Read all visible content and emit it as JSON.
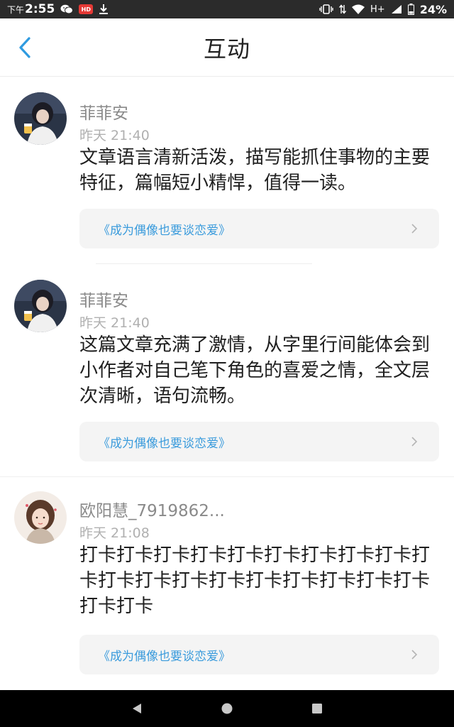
{
  "status_bar": {
    "time_prefix": "下午",
    "time": "2:55",
    "network": "H+",
    "battery": "24%",
    "hd_badge": "HD",
    "icons": [
      "wechat-icon",
      "hd-video-icon",
      "download-icon",
      "vibrate-icon",
      "data-arrows-icon",
      "wifi-icon",
      "signal-icon",
      "battery-icon"
    ]
  },
  "header": {
    "title": "互动",
    "back_icon": "chevron-left-icon"
  },
  "theme": {
    "accent": "#3a9bdc",
    "status_bg": "#2b2b2b",
    "link_bg": "#f4f4f4",
    "nav_bg": "#000000"
  },
  "comments": [
    {
      "name": "菲菲安",
      "time": "昨天 21:40",
      "text": "文章语言清新活泼，描写能抓住事物的主要特征，篇幅短小精悍，值得一读。",
      "article": "《成为偶像也要谈恋爱》"
    },
    {
      "name": "菲菲安",
      "time": "昨天 21:40",
      "text": "这篇文章充满了激情，从字里行间能体会到小作者对自己笔下角色的喜爱之情，全文层次清晰，语句流畅。",
      "article": "《成为偶像也要谈恋爱》"
    },
    {
      "name": "欧阳慧_7919862...",
      "time": "昨天 21:08",
      "text": "打卡打卡打卡打卡打卡打卡打卡打卡打卡打卡打卡打卡打卡打卡打卡打卡打卡打卡打卡打卡打卡",
      "article": "《成为偶像也要谈恋爱》"
    }
  ],
  "nav": {
    "icons": [
      "back-triangle-icon",
      "home-circle-icon",
      "recents-square-icon"
    ]
  }
}
